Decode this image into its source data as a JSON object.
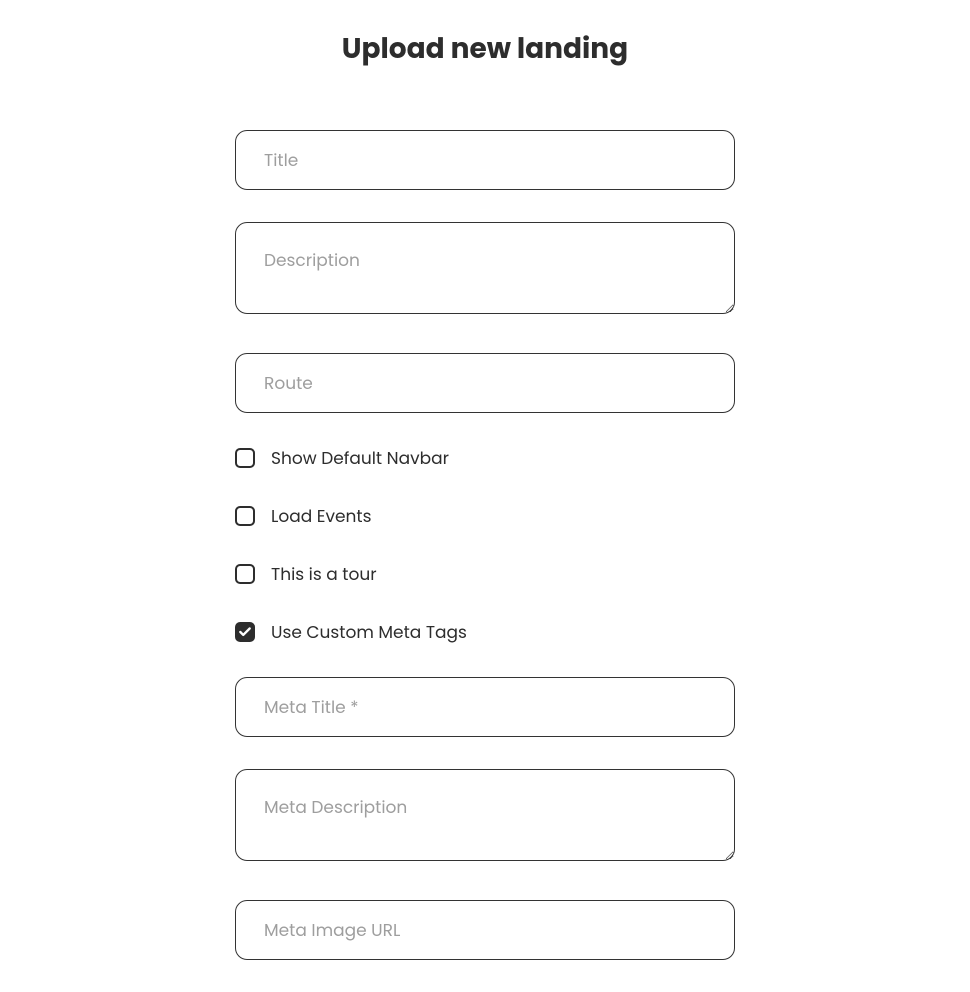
{
  "page": {
    "title": "Upload new landing"
  },
  "form": {
    "title": {
      "placeholder": "Title",
      "value": ""
    },
    "description": {
      "placeholder": "Description",
      "value": ""
    },
    "route": {
      "placeholder": "Route",
      "value": ""
    },
    "meta_title": {
      "placeholder": "Meta Title *",
      "value": ""
    },
    "meta_description": {
      "placeholder": "Meta Description",
      "value": ""
    },
    "meta_image_url": {
      "placeholder": "Meta Image URL",
      "value": ""
    }
  },
  "checkboxes": {
    "show_navbar": {
      "label": "Show Default Navbar",
      "checked": false
    },
    "load_events": {
      "label": "Load Events",
      "checked": false
    },
    "is_tour": {
      "label": "This is a tour",
      "checked": false
    },
    "custom_meta": {
      "label": "Use Custom Meta Tags",
      "checked": true
    }
  }
}
